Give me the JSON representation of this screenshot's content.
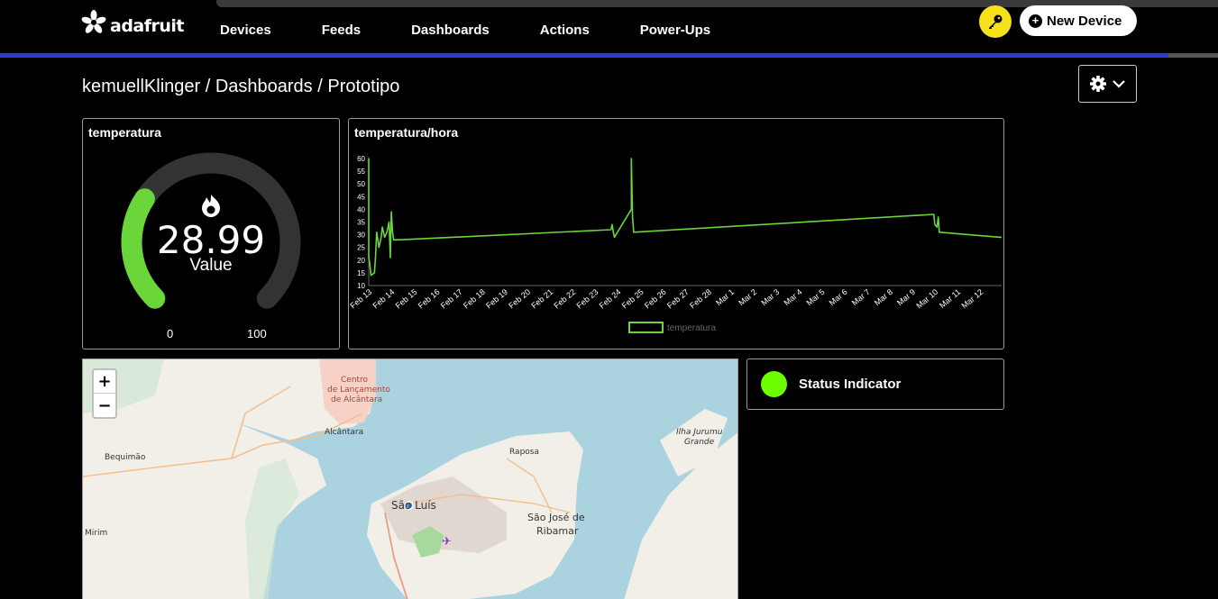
{
  "header": {
    "brand": "adafruit",
    "nav": [
      {
        "label": "Devices"
      },
      {
        "label": "Feeds"
      },
      {
        "label": "Dashboards"
      },
      {
        "label": "Actions"
      },
      {
        "label": "Power-Ups"
      }
    ],
    "new_device_label": "New Device",
    "accent_color": "#2c3bd8"
  },
  "breadcrumb": "kemuellKlinger / Dashboards / Prototipo",
  "gauge": {
    "title": "temperatura",
    "value": "28.99",
    "value_label": "Value",
    "min": "0",
    "max": "100",
    "fill_fraction": 0.2899,
    "fill_color": "#6ad63a"
  },
  "chart": {
    "title": "temperatura/hora",
    "chart_data": {
      "type": "line",
      "ylim": [
        10,
        60
      ],
      "yticks": [
        "60",
        "55",
        "50",
        "45",
        "40",
        "35",
        "30",
        "25",
        "20",
        "15",
        "10"
      ],
      "xticks": [
        "Feb 13",
        "Feb 14",
        "Feb 15",
        "Feb 16",
        "Feb 17",
        "Feb 18",
        "Feb 19",
        "Feb 20",
        "Feb 21",
        "Feb 22",
        "Feb 23",
        "Feb 24",
        "Feb 25",
        "Feb 26",
        "Feb 27",
        "Feb 28",
        "Mar 1",
        "Mar 2",
        "Mar 3",
        "Mar 4",
        "Mar 5",
        "Mar 6",
        "Mar 7",
        "Mar 8",
        "Mar 9",
        "Mar 10",
        "Mar 11",
        "Mar 12"
      ],
      "series": [
        {
          "name": "temperatura",
          "color": "#6ad63a",
          "x": [
            0.0,
            0.0,
            0.02,
            0.05,
            0.1,
            0.25,
            0.3,
            0.35,
            0.45,
            0.55,
            0.6,
            0.7,
            0.8,
            0.9,
            0.95,
            1.0,
            1.05,
            1.1,
            1.15,
            1.2,
            1.25,
            1.3,
            1.4,
            10.7,
            10.75,
            10.8,
            10.85,
            11.6,
            11.6,
            11.65,
            11.7,
            11.7,
            24.95,
            25.0,
            25.1,
            25.15,
            25.2,
            27.9,
            27.95
          ],
          "y": [
            60,
            21,
            20,
            18,
            14,
            15,
            21,
            31,
            25,
            29,
            33,
            29,
            31,
            35,
            21,
            39,
            31,
            28,
            28,
            28,
            28,
            28,
            28,
            32,
            34,
            31,
            29,
            40,
            60,
            37,
            31,
            31,
            38,
            34,
            33,
            37,
            31,
            29,
            29
          ]
        }
      ],
      "legend_position": "bottom"
    }
  },
  "map": {
    "zoom_in": "+",
    "zoom_out": "−",
    "labels": [
      {
        "id": "centro",
        "text": "Centro"
      },
      {
        "id": "de-lancamento",
        "text": "de Lançamento"
      },
      {
        "id": "de-alcantara",
        "text": "de Alcântara"
      },
      {
        "id": "alcantara",
        "text": "Alcântara"
      },
      {
        "id": "bequimao",
        "text": "Bequimão"
      },
      {
        "id": "raposa",
        "text": "Raposa"
      },
      {
        "id": "ilha-jurumu",
        "text": "Ilha Jurumu"
      },
      {
        "id": "grande",
        "text": "Grande"
      },
      {
        "id": "sao-luis",
        "text": "São Luís"
      },
      {
        "id": "sao-jose-de",
        "text": "São José de"
      },
      {
        "id": "ribamar",
        "text": "Ribamar"
      },
      {
        "id": "mirim",
        "text": "Mirim"
      }
    ]
  },
  "status": {
    "label": "Status Indicator",
    "color": "#6cff00"
  }
}
